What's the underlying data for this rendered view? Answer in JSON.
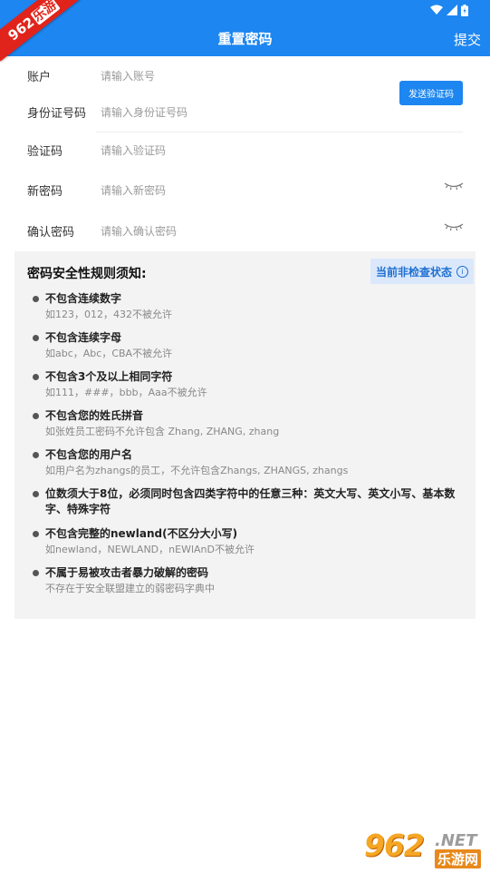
{
  "header": {
    "title": "重置密码",
    "submit_label": "提交"
  },
  "watermark": {
    "corner_badge_num": "962",
    "corner_badge_cn": "乐游",
    "brand_num": "962",
    "brand_net": ".NET",
    "brand_cn": "乐游网"
  },
  "form": {
    "account": {
      "label": "账户",
      "placeholder": "请输入账号"
    },
    "id_number": {
      "label": "身份证号码",
      "placeholder": "请输入身份证号码"
    },
    "verify_code": {
      "label": "验证码",
      "placeholder": "请输入验证码",
      "send_button": "发送验证码"
    },
    "new_password": {
      "label": "新密码",
      "placeholder": "请输入新密码"
    },
    "confirm_password": {
      "label": "确认密码",
      "placeholder": "请输入确认密码"
    }
  },
  "rules": {
    "heading": "密码安全性规则须知:",
    "check_status": "当前非检查状态",
    "items": [
      {
        "title": "不包含连续数字",
        "desc": "如123，012，432不被允许"
      },
      {
        "title": "不包含连续字母",
        "desc": "如abc，Abc，CBA不被允许"
      },
      {
        "title": "不包含3个及以上相同字符",
        "desc": "如111，###，bbb，Aaa不被允许"
      },
      {
        "title": "不包含您的姓氏拼音",
        "desc": "如张姓员工密码不允许包含 Zhang, ZHANG, zhang"
      },
      {
        "title": "不包含您的用户名",
        "desc": "如用户名为zhangs的员工，不允许包含Zhangs, ZHANGS, zhangs"
      },
      {
        "title": "位数须大于8位，必须同时包含四类字符中的任意三种：英文大写、英文小写、基本数字、特殊字符",
        "desc": ""
      },
      {
        "title": "不包含完整的newland(不区分大小写)",
        "desc": "如newland，NEWLAND，nEWlAnD不被允许"
      },
      {
        "title": "不属于易被攻击者暴力破解的密码",
        "desc": "不存在于安全联盟建立的弱密码字典中"
      }
    ]
  },
  "colors": {
    "primary": "#1d86f0",
    "panel_bg": "#f3f3f3",
    "status_chip_bg": "#dbe8fb"
  }
}
